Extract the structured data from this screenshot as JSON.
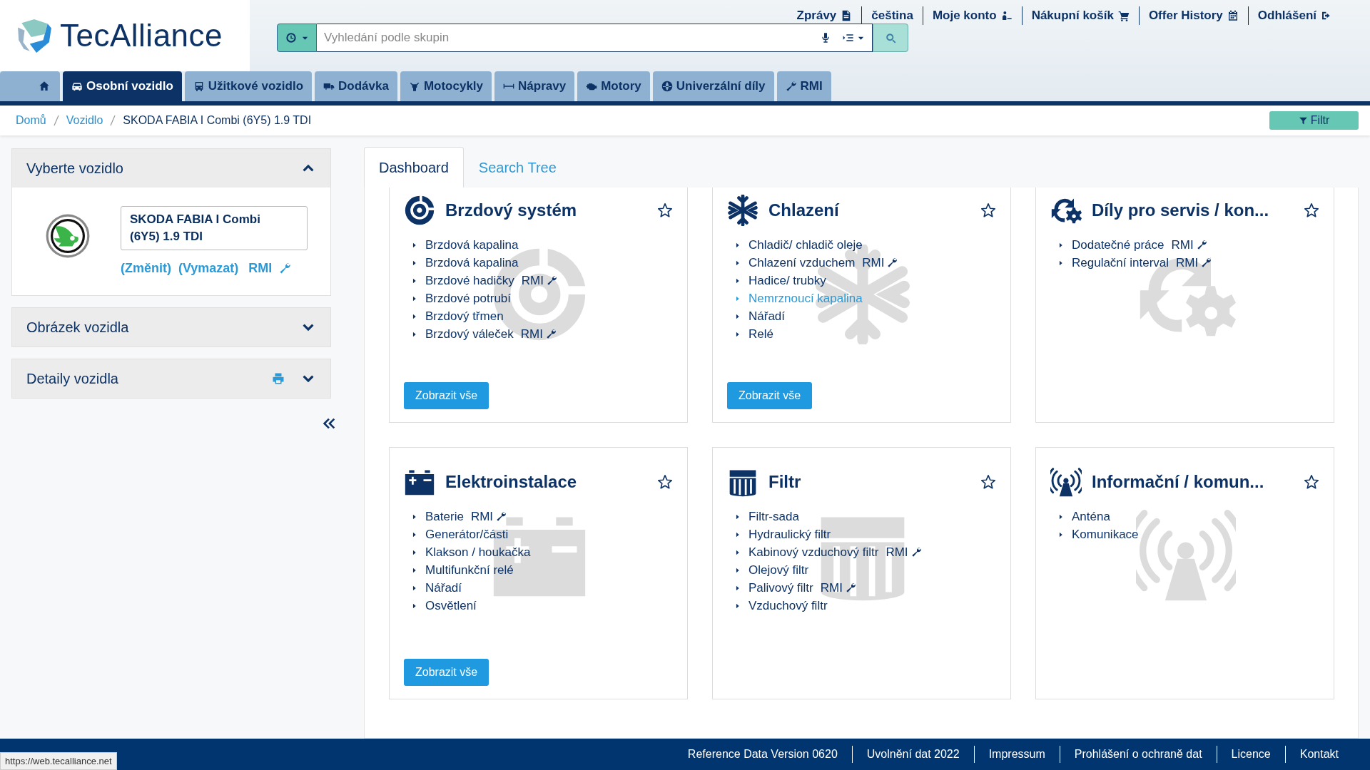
{
  "logo": {
    "text": "TecAlliance"
  },
  "top_links": [
    {
      "label": "Zprávy",
      "kind": "document"
    },
    {
      "label": "čeština"
    },
    {
      "label": "Moje konto",
      "kind": "user"
    },
    {
      "label": "Nákupní košík",
      "kind": "cart"
    },
    {
      "label": "Offer History",
      "kind": "calendar"
    },
    {
      "label": "Odhlášení",
      "kind": "logout"
    }
  ],
  "search": {
    "placeholder": "Vyhledání podle skupin"
  },
  "nav_tabs": [
    {
      "kind": "home",
      "selected": false
    },
    {
      "label": "Osobní vozidlo",
      "kind": "car",
      "selected": true
    },
    {
      "label": "Užitkové vozidlo",
      "kind": "bus",
      "selected": false
    },
    {
      "label": "Dodávka",
      "kind": "truck",
      "selected": false
    },
    {
      "label": "Motocykly",
      "kind": "moto",
      "selected": false
    },
    {
      "label": "Nápravy",
      "kind": "axle",
      "selected": false
    },
    {
      "label": "Motory",
      "kind": "engine",
      "selected": false
    },
    {
      "label": "Univerzální díly",
      "kind": "globe",
      "selected": false
    },
    {
      "label": "RMI",
      "kind": "wrench",
      "selected": false
    }
  ],
  "breadcrumb": [
    "Domů",
    "Vozidlo",
    "SKODA FABIA I Combi (6Y5) 1.9 TDI"
  ],
  "filter_button": "Filtr",
  "vehicle_panels": [
    {
      "title": "Vyberte vozidlo",
      "expanded": true,
      "vehicle": "SKODA FABIA I Combi (6Y5) 1.9 TDI",
      "links": [
        "(Změnit)",
        "(Vymazat)"
      ],
      "rmi": "RMI"
    },
    {
      "title": "Obrázek vozidla",
      "expanded": false
    },
    {
      "title": "Detaily vozidla",
      "expanded": false,
      "printable": true
    }
  ],
  "content_tabs": [
    {
      "label": "Dashboard",
      "selected": true
    },
    {
      "label": "Search Tree",
      "selected": false
    }
  ],
  "cards": [
    {
      "title": "Brzdový systém",
      "kind": "brake",
      "favorite": false,
      "button": "Zobrazit vše",
      "items": [
        {
          "label": "Brzdová kapalina",
          "highlighted": false
        },
        {
          "label": "Brzdová kapalina",
          "highlighted": false
        },
        {
          "label": "Brzdové hadičky",
          "rmi": "RMI",
          "highlighted": false
        },
        {
          "label": "Brzdové potrubí",
          "highlighted": false
        },
        {
          "label": "Brzdový třmen",
          "highlighted": false
        },
        {
          "label": "Brzdový váleček",
          "rmi": "RMI",
          "highlighted": false
        }
      ]
    },
    {
      "title": "Chlazení",
      "kind": "snowflake",
      "favorite": false,
      "button": "Zobrazit vše",
      "items": [
        {
          "label": "Chladič/ chladič oleje",
          "highlighted": false
        },
        {
          "label": "Chlazení vzduchem",
          "rmi": "RMI",
          "highlighted": false
        },
        {
          "label": "Hadice/ trubky",
          "highlighted": false
        },
        {
          "label": "Nemrznoucí kapalina",
          "highlighted": true
        },
        {
          "label": "Nářadí",
          "highlighted": false
        },
        {
          "label": "Relé",
          "highlighted": false
        }
      ]
    },
    {
      "title": "Díly pro servis / kon...",
      "kind": "service",
      "favorite": false,
      "items": [
        {
          "label": "Dodatečné práce",
          "rmi": "RMI",
          "highlighted": false
        },
        {
          "label": "Regulační interval",
          "rmi": "RMI",
          "highlighted": false
        }
      ]
    },
    {
      "title": "Elektroinstalace",
      "kind": "battery",
      "favorite": false,
      "button": "Zobrazit vše",
      "items": [
        {
          "label": "Baterie",
          "rmi": "RMI",
          "highlighted": false
        },
        {
          "label": "Generátor/části",
          "highlighted": false
        },
        {
          "label": "Klakson / houkačka",
          "highlighted": false
        },
        {
          "label": "Multifunkční relé",
          "highlighted": false
        },
        {
          "label": "Nářadí",
          "highlighted": false
        },
        {
          "label": "Osvětlení",
          "highlighted": false
        }
      ]
    },
    {
      "title": "Filtr",
      "kind": "filter",
      "favorite": false,
      "items": [
        {
          "label": "Filtr-sada",
          "highlighted": false
        },
        {
          "label": "Hydraulický filtr",
          "highlighted": false
        },
        {
          "label": "Kabinový vzduchový filtr",
          "rmi": "RMI",
          "highlighted": false
        },
        {
          "label": "Olejový filtr",
          "highlighted": false
        },
        {
          "label": "Palivový filtr",
          "rmi": "RMI",
          "highlighted": false
        },
        {
          "label": "Vzduchový filtr",
          "highlighted": false
        }
      ]
    },
    {
      "title": "Informační / komun...",
      "kind": "antenna",
      "favorite": false,
      "items": [
        {
          "label": "Anténa",
          "highlighted": false
        },
        {
          "label": "Komunikace",
          "highlighted": false
        }
      ]
    }
  ],
  "footer_links": [
    "Reference Data Version 0620",
    "Uvolnění dat 2022",
    "Impressum",
    "Prohlášení o ochraně dat",
    "Licence",
    "Kontakt"
  ],
  "status_url": "https://web.tecalliance.net"
}
